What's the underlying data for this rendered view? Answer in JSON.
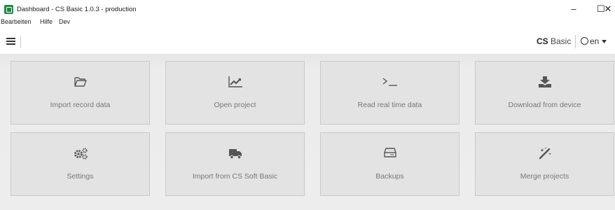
{
  "window": {
    "title": "Dashboard - CS Basic 1.0.3 - production",
    "controls": {
      "minimize": "–",
      "maximize": "☐",
      "close": "✕"
    }
  },
  "menu": {
    "items": [
      "Bearbeiten",
      "Hilfe",
      "Dev"
    ]
  },
  "header": {
    "brand_bold": "CS",
    "brand_rest": " Basic",
    "language": "en"
  },
  "tiles": [
    {
      "label": "Import record data",
      "icon": "folder-open-icon"
    },
    {
      "label": "Open project",
      "icon": "line-chart-icon"
    },
    {
      "label": "Read real time data",
      "icon": "terminal-icon"
    },
    {
      "label": "Download from device",
      "icon": "download-icon"
    },
    {
      "label": "Settings",
      "icon": "cogs-icon"
    },
    {
      "label": "Import from CS Soft Basic",
      "icon": "truck-icon"
    },
    {
      "label": "Backups",
      "icon": "hdd-icon"
    },
    {
      "label": "Merge projects",
      "icon": "magic-wand-icon"
    }
  ],
  "colors": {
    "icon": "#555555",
    "label": "#777777",
    "tile_bg": "#e3e3e3",
    "app_icon": "#1d8a48"
  }
}
